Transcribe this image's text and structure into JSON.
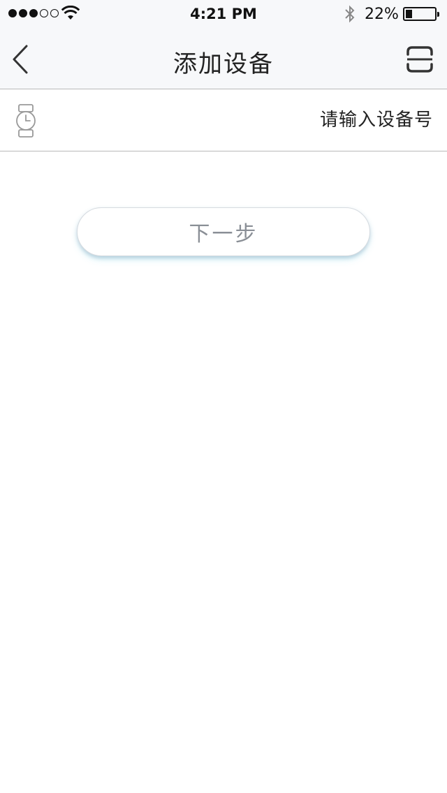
{
  "status_bar": {
    "time": "4:21 PM",
    "battery_percent": "22%",
    "signal_bars_filled": 3,
    "signal_bars_total": 5,
    "icons": [
      "wifi-icon",
      "bluetooth-icon",
      "battery-icon"
    ]
  },
  "nav": {
    "title": "添加设备",
    "back_icon": "chevron-left-icon",
    "scan_icon": "scan-icon"
  },
  "device_input": {
    "placeholder": "请输入设备号",
    "value": "",
    "icon": "watch-icon"
  },
  "next_button": {
    "label": "下一步"
  },
  "colors": {
    "bar_background": "#f7f8fa",
    "divider": "#b9b9b9",
    "button_text": "#8a8f96"
  }
}
